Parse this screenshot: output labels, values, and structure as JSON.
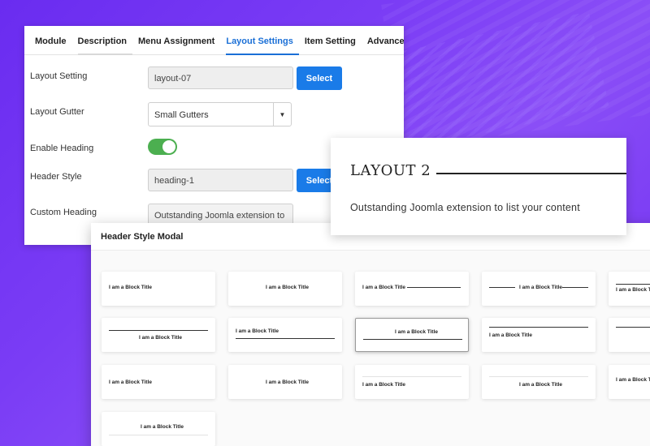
{
  "settings": {
    "tabs": [
      "Module",
      "Description",
      "Menu Assignment",
      "Layout Settings",
      "Item Setting",
      "Advanced"
    ],
    "layout_setting": {
      "label": "Layout Setting",
      "value": "layout-07",
      "button": "Select"
    },
    "layout_gutter": {
      "label": "Layout Gutter",
      "value": "Small Gutters"
    },
    "enable_heading": {
      "label": "Enable Heading",
      "on": true
    },
    "header_style": {
      "label": "Header Style",
      "value": "heading-1",
      "button": "Select"
    },
    "custom_heading": {
      "label": "Custom Heading",
      "value": "Outstanding Joomla extension to"
    }
  },
  "preview": {
    "title": "LAYOUT 2",
    "subtitle": "Outstanding Joomla extension to list your content"
  },
  "modal": {
    "title": "Header Style Modal",
    "block_title": "I am a Block Title"
  },
  "colors": {
    "accent": "#1a7be8",
    "toggle": "#4caf50",
    "background": "#7a3cf5"
  }
}
